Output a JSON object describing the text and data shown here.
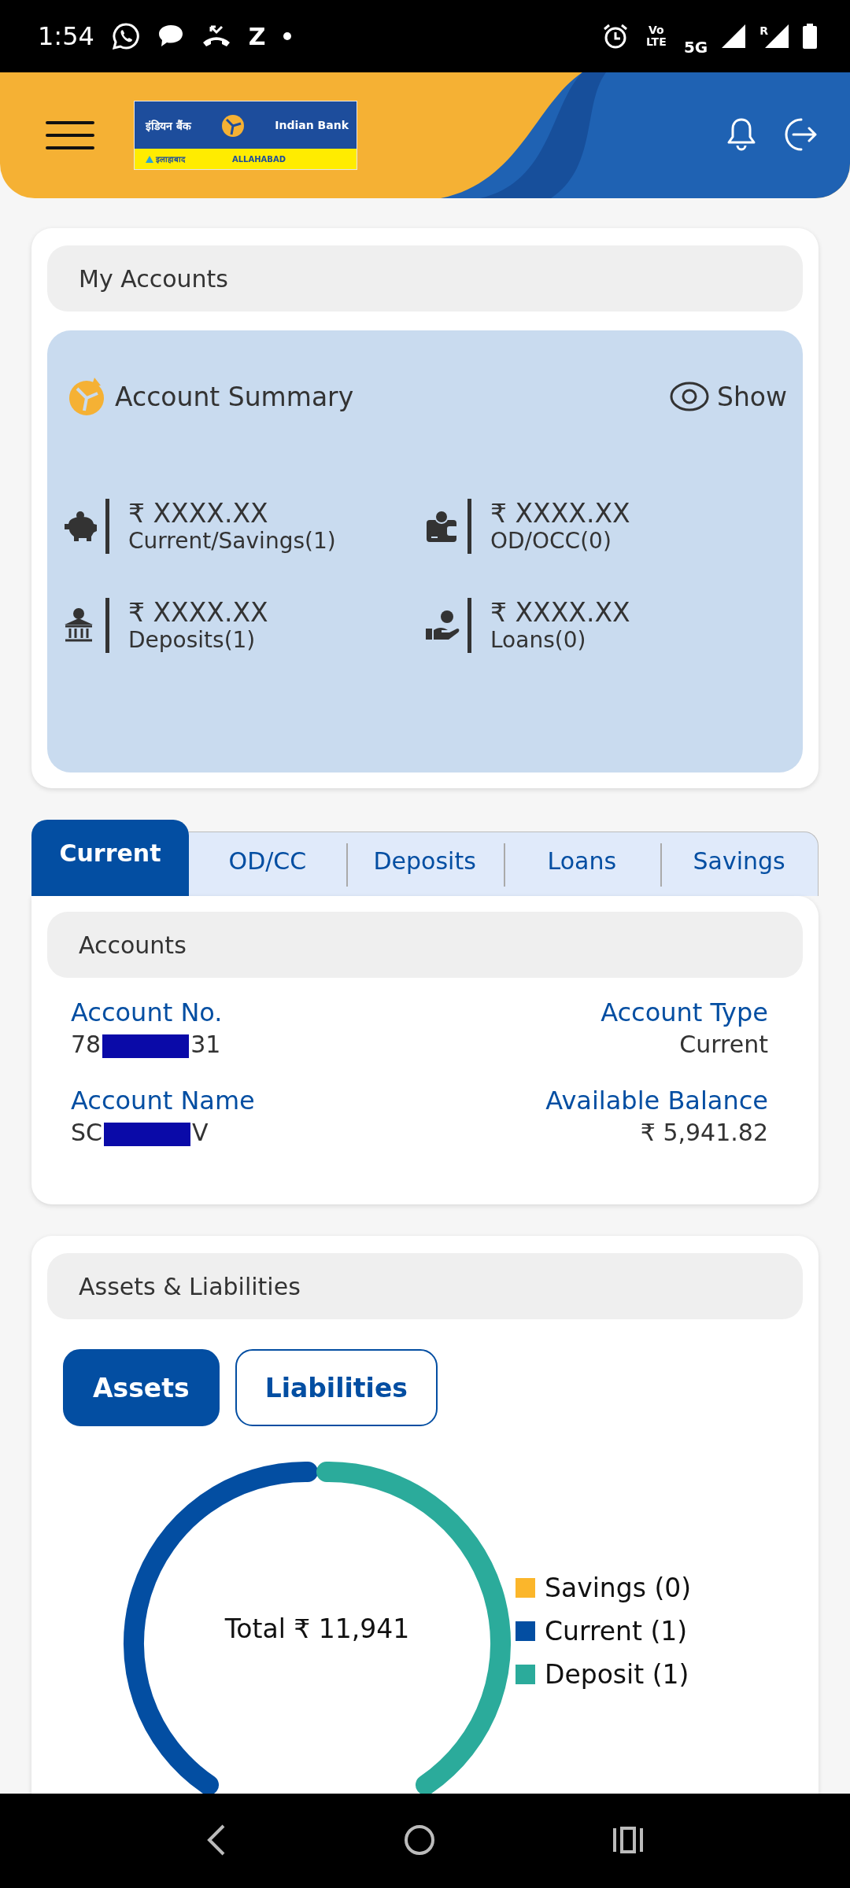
{
  "status_bar": {
    "time": "1:54",
    "notification_letter": "Z",
    "volte": "Vo LTE",
    "network": "5G",
    "roaming": "R"
  },
  "header": {
    "logo": {
      "hindi_name": "इंडियन बैंक",
      "english_name": "Indian Bank",
      "hindi_sub": "इलाहाबाद",
      "english_sub": "ALLAHABAD"
    }
  },
  "my_accounts": {
    "title": "My Accounts",
    "summary": {
      "title": "Account Summary",
      "show_label": "Show",
      "items": [
        {
          "kind": "savings",
          "amount": "₹ XXXX.XX",
          "label": "Current/Savings(1)"
        },
        {
          "kind": "overdraft",
          "amount": "₹ XXXX.XX",
          "label": "OD/OCC(0)"
        },
        {
          "kind": "deposits",
          "amount": "₹ XXXX.XX",
          "label": "Deposits(1)"
        },
        {
          "kind": "loans",
          "amount": "₹ XXXX.XX",
          "label": "Loans(0)"
        }
      ]
    }
  },
  "account_tabs": [
    {
      "label": "Current",
      "selected": true
    },
    {
      "label": "OD/CC",
      "selected": false
    },
    {
      "label": "Deposits",
      "selected": false
    },
    {
      "label": "Loans",
      "selected": false
    },
    {
      "label": "Savings",
      "selected": false
    }
  ],
  "accounts_panel": {
    "title": "Accounts",
    "fields": [
      {
        "label": "Account No.",
        "value_start": "78",
        "value_end": "31",
        "redacted": true
      },
      {
        "label": "Account Type",
        "value": "Current",
        "redacted": false
      },
      {
        "label": "Account Name",
        "value_start": "SC",
        "value_end": "V",
        "redacted": true
      },
      {
        "label": "Available Balance",
        "value": "₹ 5,941.82",
        "redacted": false
      }
    ]
  },
  "assets_liabilities": {
    "title": "Assets & Liabilities",
    "toggle": [
      {
        "label": "Assets",
        "selected": true
      },
      {
        "label": "Liabilities",
        "selected": false
      }
    ],
    "total": "Total ₹ 11,941",
    "legend": [
      {
        "label": "Savings (0)",
        "color": "#fbb62b"
      },
      {
        "label": "Current (1)",
        "color": "#034ea2"
      },
      {
        "label": "Deposit (1)",
        "color": "#2bab9b"
      }
    ]
  }
}
